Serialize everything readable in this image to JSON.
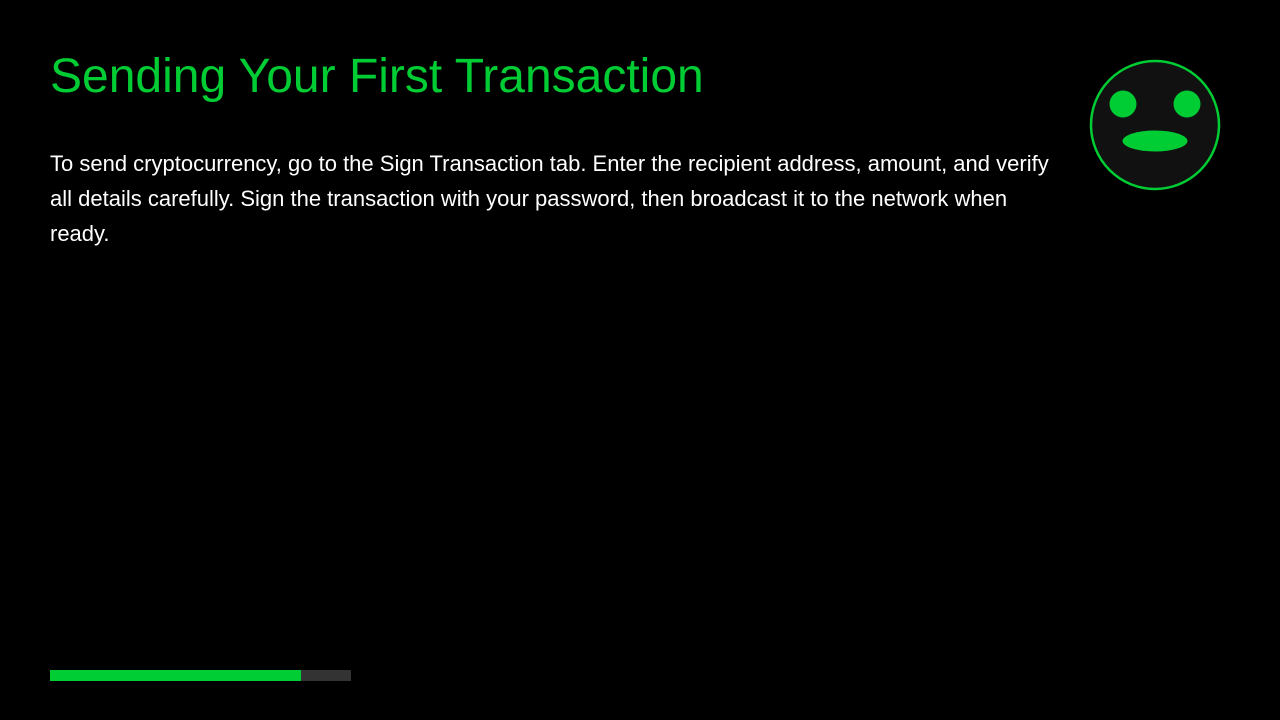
{
  "slide": {
    "title": "Sending Your First Transaction",
    "body": "To send cryptocurrency, go to the Sign Transaction tab. Enter the recipient address, amount, and verify all details carefully. Sign the transaction with your password, then broadcast it to the network when ready."
  },
  "mascot": {
    "icon": "smiley-face-icon"
  },
  "progress": {
    "fraction": 0.833
  },
  "colors": {
    "accent": "#00cc33",
    "background": "#000000",
    "text": "#ffffff",
    "track": "#333333",
    "face": "#111111"
  }
}
